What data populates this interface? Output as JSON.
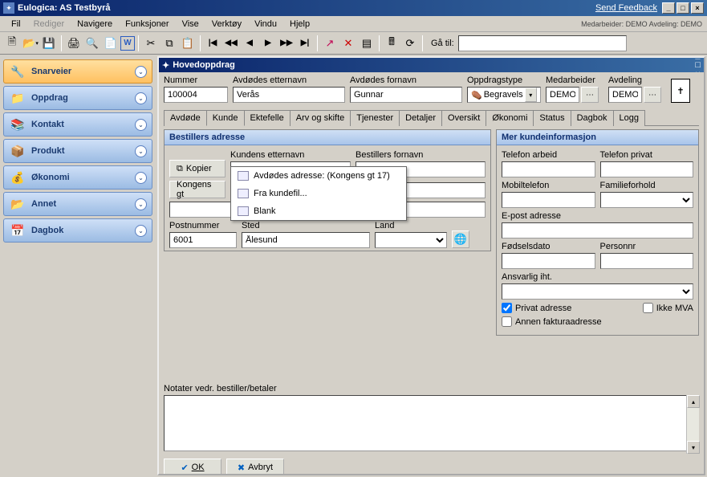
{
  "title": "Eulogica: AS Testbyrå",
  "feedback": "Send Feedback",
  "menus": [
    "Fil",
    "Rediger",
    "Navigere",
    "Funksjoner",
    "Vise",
    "Verktøy",
    "Vindu",
    "Hjelp"
  ],
  "status_label": "Medarbeider: DEMO   Avdeling: DEMO",
  "goto_label": "Gå til:",
  "sidebar": [
    {
      "label": "Snarveier",
      "icon": "🔧",
      "orange": true
    },
    {
      "label": "Oppdrag",
      "icon": "📁"
    },
    {
      "label": "Kontakt",
      "icon": "📚"
    },
    {
      "label": "Produkt",
      "icon": "📦"
    },
    {
      "label": "Økonomi",
      "icon": "💰"
    },
    {
      "label": "Annet",
      "icon": "📂"
    },
    {
      "label": "Dagbok",
      "icon": "📅"
    }
  ],
  "mdi_title": "Hovedoppdrag",
  "header": {
    "nummer_label": "Nummer",
    "nummer": "100004",
    "etternavn_label": "Avdødes etternavn",
    "etternavn": "Verås",
    "fornavn_label": "Avdødes fornavn",
    "fornavn": "Gunnar",
    "oppdragstype_label": "Oppdragstype",
    "oppdragstype": "Begravels",
    "medarbeider_label": "Medarbeider",
    "medarbeider": "DEMO",
    "avdeling_label": "Avdeling",
    "avdeling": "DEMO"
  },
  "tabs": [
    "Avdøde",
    "Kunde",
    "Ektefelle",
    "Arv og skifte",
    "Tjenester",
    "Detaljer",
    "Oversikt",
    "Økonomi",
    "Status",
    "Dagbok",
    "Logg"
  ],
  "active_tab": 1,
  "left_panel_title": "Bestillers adresse",
  "right_panel_title": "Mer kundeinformasjon",
  "kopier_label": "Kopier",
  "popup": [
    "Avdødes adresse:  (Kongens gt 17)",
    "Fra kundefil...",
    "Blank"
  ],
  "left_fields": {
    "kundens_etternavn": "Kundens etternavn",
    "bestillers_fornavn": "Bestillers fornavn",
    "addr_btn": "Kongens gt",
    "postnummer_label": "Postnummer",
    "postnummer": "6001",
    "sted_label": "Sted",
    "sted": "Ålesund",
    "land_label": "Land"
  },
  "right_fields": {
    "telefon_arbeid": "Telefon arbeid",
    "telefon_privat": "Telefon privat",
    "mobiltelefon": "Mobiltelefon",
    "familieforhold": "Familieforhold",
    "epost": "E-post adresse",
    "fodselsdato": "Fødselsdato",
    "personnr": "Personnr",
    "ansvarlig": "Ansvarlig iht.",
    "privat_adresse": "Privat adresse",
    "ikke_mva": "Ikke MVA",
    "annen_faktura": "Annen fakturaadresse"
  },
  "notes_label": "Notater vedr. bestiller/betaler",
  "ok_label": "OK",
  "avbryt_label": "Avbryt"
}
